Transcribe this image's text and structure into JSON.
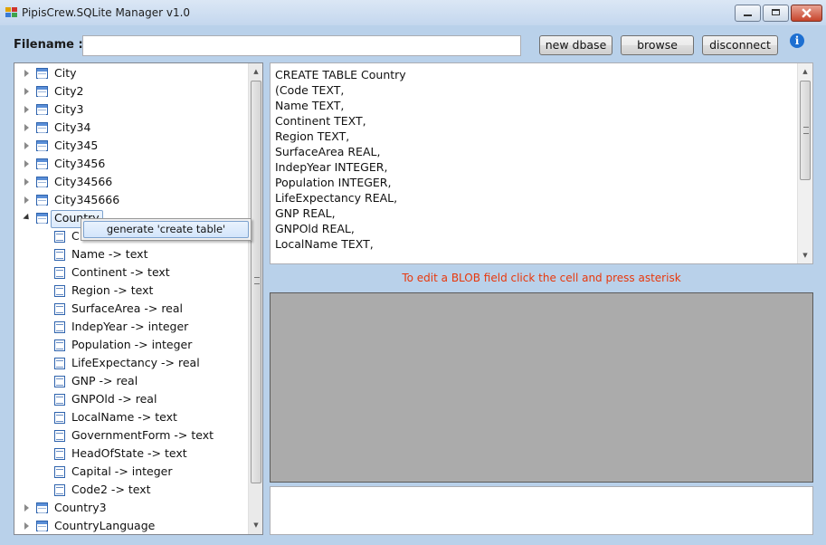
{
  "window": {
    "title": "PipisCrew.SQLite Manager v1.0"
  },
  "toolbar": {
    "filename_label": "Filename :",
    "filename_value": "",
    "new_dbase": "new dbase",
    "browse": "browse",
    "disconnect": "disconnect",
    "info_glyph": "i"
  },
  "tree": {
    "tables_before": [
      "City",
      "City2",
      "City3",
      "City34",
      "City345",
      "City3456",
      "City34566",
      "City345666"
    ],
    "expanded_table": "Country",
    "partial_column": "C",
    "columns": [
      "Name -> text",
      "Continent -> text",
      "Region -> text",
      "SurfaceArea -> real",
      "IndepYear -> integer",
      "Population -> integer",
      "LifeExpectancy -> real",
      "GNP -> real",
      "GNPOld -> real",
      "LocalName -> text",
      "GovernmentForm -> text",
      "HeadOfState -> text",
      "Capital -> integer",
      "Code2 -> text"
    ],
    "tables_after": [
      "Country3",
      "CountryLanguage"
    ]
  },
  "context_menu": {
    "item": "generate 'create table'"
  },
  "sql_lines": [
    "CREATE TABLE Country",
    "(Code TEXT,",
    "Name TEXT,",
    "Continent TEXT,",
    "Region TEXT,",
    "SurfaceArea REAL,",
    "IndepYear INTEGER,",
    "Population INTEGER,",
    "LifeExpectancy REAL,",
    "GNP REAL,",
    "GNPOld REAL,",
    "LocalName TEXT,"
  ],
  "blob_note": "To edit a BLOB field click the cell and press asterisk",
  "icons": {
    "app": "app-icon",
    "table": "table-icon",
    "column": "column-icon",
    "info": "info-icon"
  },
  "colors": {
    "window_bg": "#b9d1ea",
    "blob_note": "#e8380c",
    "grid_bg": "#ababab",
    "info": "#1d6fd1"
  }
}
